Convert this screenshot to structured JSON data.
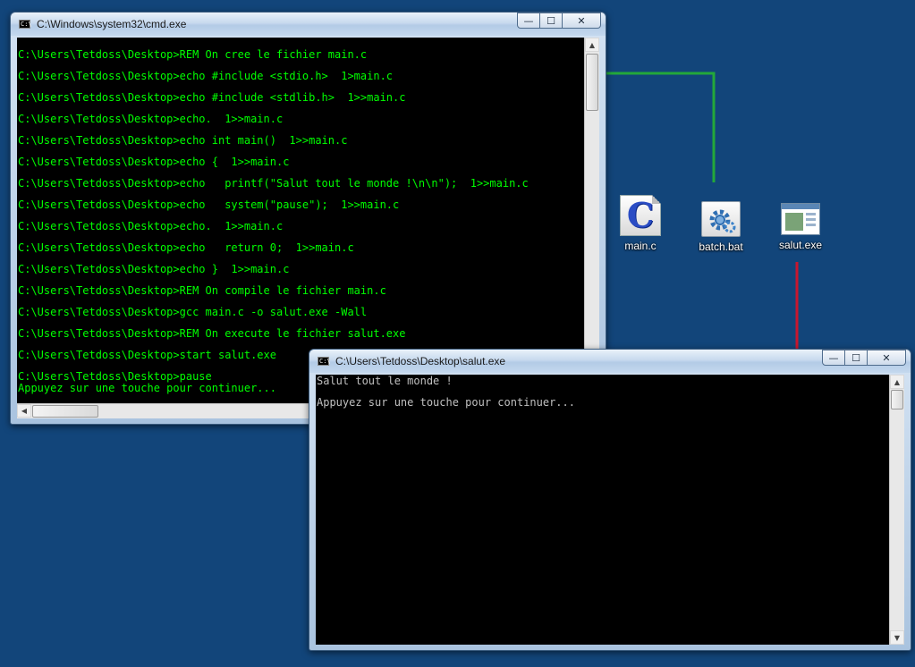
{
  "colors": {
    "desktop_bg": "#12457a",
    "cmd_text": "#00ff00",
    "salut_text": "#c0c0c0",
    "connector_green": "#23a83a",
    "connector_red": "#c8162e"
  },
  "cmd_window": {
    "title": "C:\\Windows\\system32\\cmd.exe",
    "icon": "console-icon",
    "lines": [
      "C:\\Users\\Tetdoss\\Desktop>REM On cree le fichier main.c",
      "C:\\Users\\Tetdoss\\Desktop>echo #include <stdio.h>  1>main.c",
      "C:\\Users\\Tetdoss\\Desktop>echo #include <stdlib.h>  1>>main.c",
      "C:\\Users\\Tetdoss\\Desktop>echo.  1>>main.c",
      "C:\\Users\\Tetdoss\\Desktop>echo int main()  1>>main.c",
      "C:\\Users\\Tetdoss\\Desktop>echo {  1>>main.c",
      "C:\\Users\\Tetdoss\\Desktop>echo   printf(\"Salut tout le monde !\\n\\n\");  1>>main.c",
      "C:\\Users\\Tetdoss\\Desktop>echo   system(\"pause\");  1>>main.c",
      "C:\\Users\\Tetdoss\\Desktop>echo.  1>>main.c",
      "C:\\Users\\Tetdoss\\Desktop>echo   return 0;  1>>main.c",
      "C:\\Users\\Tetdoss\\Desktop>echo }  1>>main.c",
      "C:\\Users\\Tetdoss\\Desktop>REM On compile le fichier main.c",
      "C:\\Users\\Tetdoss\\Desktop>gcc main.c -o salut.exe -Wall",
      "C:\\Users\\Tetdoss\\Desktop>REM On execute le fichier salut.exe",
      "C:\\Users\\Tetdoss\\Desktop>start salut.exe",
      "C:\\Users\\Tetdoss\\Desktop>pause"
    ],
    "last_line": "Appuyez sur une touche pour continuer..."
  },
  "salut_window": {
    "title": "C:\\Users\\Tetdoss\\Desktop\\salut.exe",
    "icon": "console-icon",
    "lines": [
      "Salut tout le monde !",
      "",
      "Appuyez sur une touche pour continuer..."
    ]
  },
  "caption_buttons": {
    "minimize": "—",
    "maximize": "☐",
    "close": "✕"
  },
  "desktop_icons": [
    {
      "label": "main.c",
      "icon": "c-file-icon"
    },
    {
      "label": "batch.bat",
      "icon": "batch-file-icon"
    },
    {
      "label": "salut.exe",
      "icon": "exe-file-icon"
    }
  ]
}
